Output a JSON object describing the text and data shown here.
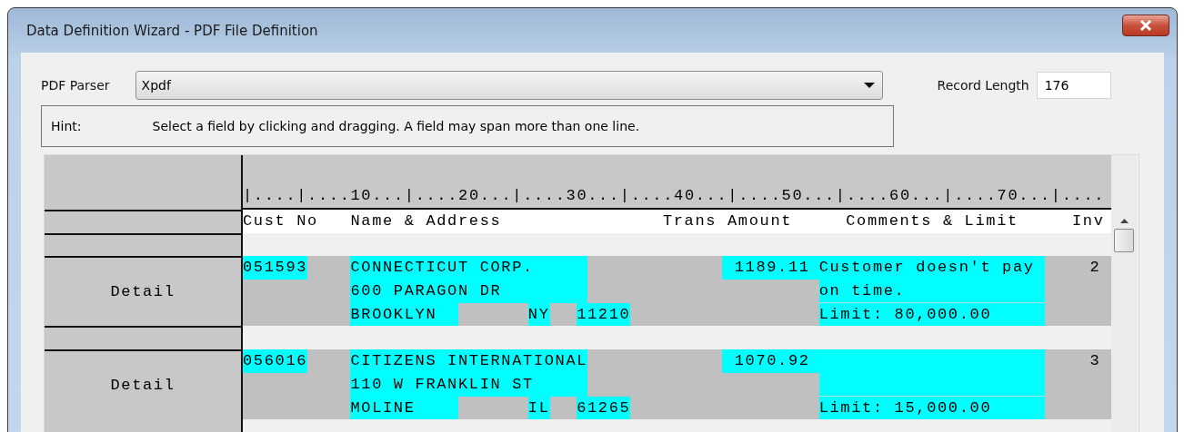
{
  "window": {
    "title": "Data Definition Wizard - PDF File Definition"
  },
  "parser": {
    "label": "PDF Parser",
    "value": "Xpdf"
  },
  "record_length": {
    "label": "Record Length",
    "value": "176"
  },
  "hint": {
    "label": "Hint:",
    "text": "Select a field by clicking and dragging. A field may span more than one line."
  },
  "viewer": {
    "ruler": "|....|....10...|....20...|....30...|....40...|....50...|....60...|....70...|....",
    "headers": [
      "Cust No",
      "Name & Address",
      "Trans Amount",
      "Comments & Limit",
      "Inv"
    ],
    "records": [
      {
        "label": "Detail",
        "cust_no": "051593",
        "name": [
          "CONNECTICUT CORP.",
          "600 PARAGON DR"
        ],
        "city": "BROOKLYN",
        "state": "NY",
        "zip": "11210",
        "amount": "1189.11",
        "comments": "Customer doesn't pay on time.",
        "limit": "Limit: 80,000.00",
        "inv": "2"
      },
      {
        "label": "Detail",
        "cust_no": "056016",
        "name": [
          "CITIZENS INTERNATIONAL",
          "110 W FRANKLIN ST"
        ],
        "city": "MOLINE",
        "state": "IL",
        "zip": "61265",
        "amount": "1070.92",
        "limit": "Limit: 15,000.00",
        "inv": "3"
      }
    ]
  }
}
